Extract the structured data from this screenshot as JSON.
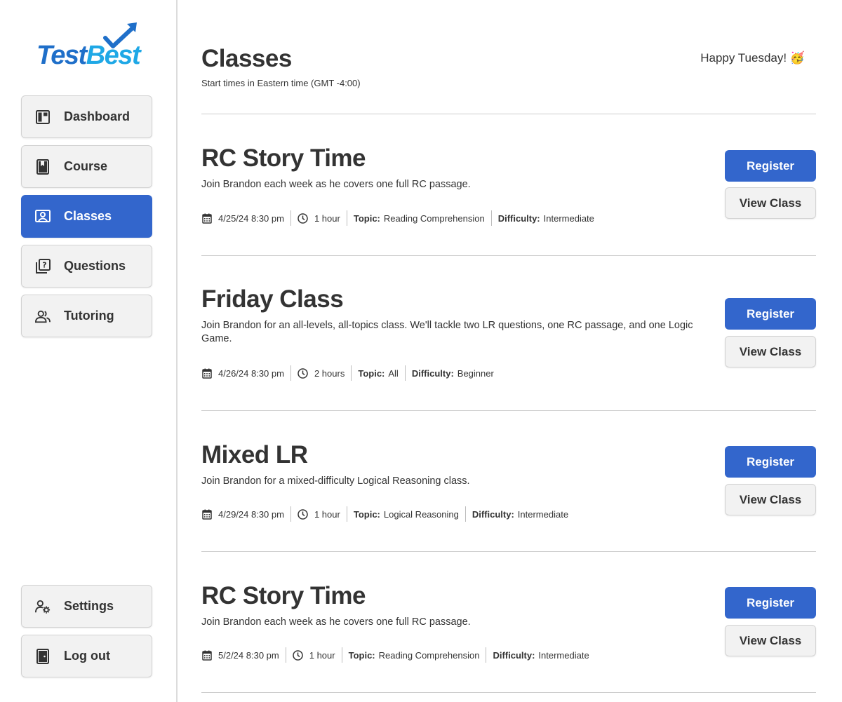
{
  "brand": {
    "name_part1": "Test",
    "name_part2": "Best",
    "accent": "#1f6fc9",
    "accent_light": "#1fa8e6"
  },
  "colors": {
    "primary": "#3366cc",
    "button_bg": "#f2f2f2",
    "text": "#333333"
  },
  "sidebar": {
    "items": [
      {
        "label": "Dashboard",
        "icon": "dashboard-icon",
        "active": false
      },
      {
        "label": "Course",
        "icon": "book-icon",
        "active": false
      },
      {
        "label": "Classes",
        "icon": "presenter-icon",
        "active": true
      },
      {
        "label": "Questions",
        "icon": "question-stack-icon",
        "active": false
      },
      {
        "label": "Tutoring",
        "icon": "people-icon",
        "active": false
      }
    ],
    "bottom_items": [
      {
        "label": "Settings",
        "icon": "user-gear-icon"
      },
      {
        "label": "Log out",
        "icon": "door-icon"
      }
    ]
  },
  "header": {
    "title": "Classes",
    "subtitle": "Start times in Eastern time (GMT -4:00)",
    "greeting": "Happy Tuesday! 🥳"
  },
  "labels": {
    "topic": "Topic:",
    "difficulty": "Difficulty:",
    "register": "Register",
    "view_class": "View Class"
  },
  "classes": [
    {
      "title": "RC Story Time",
      "description": "Join Brandon each week as he covers one full RC passage.",
      "datetime": "4/25/24 8:30 pm",
      "duration": "1 hour",
      "topic": "Reading Comprehension",
      "difficulty": "Intermediate"
    },
    {
      "title": "Friday Class",
      "description": "Join Brandon for an all-levels, all-topics class. We'll tackle two LR questions, one RC passage, and one Logic Game.",
      "datetime": "4/26/24 8:30 pm",
      "duration": "2 hours",
      "topic": "All",
      "difficulty": "Beginner"
    },
    {
      "title": "Mixed LR",
      "description": "Join Brandon for a mixed-difficulty Logical Reasoning class.",
      "datetime": "4/29/24 8:30 pm",
      "duration": "1 hour",
      "topic": "Logical Reasoning",
      "difficulty": "Intermediate"
    },
    {
      "title": "RC Story Time",
      "description": "Join Brandon each week as he covers one full RC passage.",
      "datetime": "5/2/24 8:30 pm",
      "duration": "1 hour",
      "topic": "Reading Comprehension",
      "difficulty": "Intermediate"
    }
  ]
}
